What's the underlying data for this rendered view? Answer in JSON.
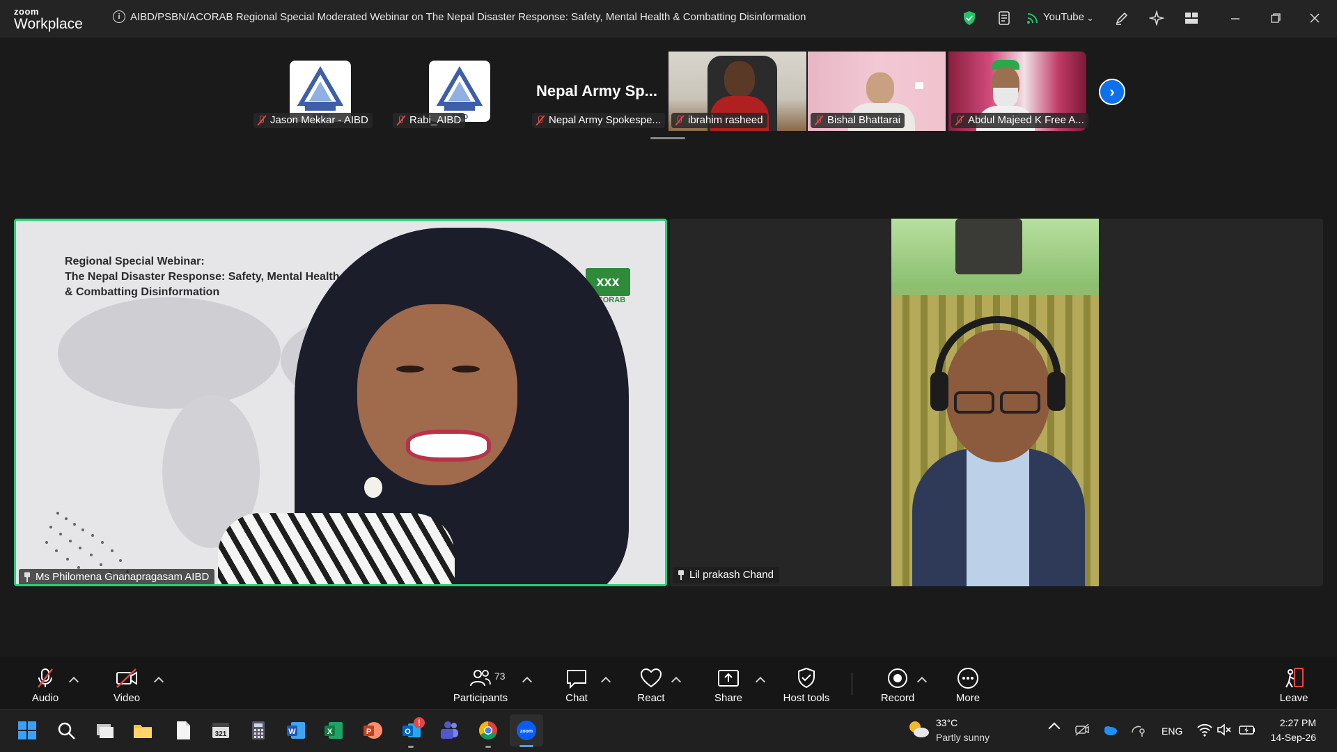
{
  "titlebar": {
    "brand_small": "zoom",
    "brand_large": "Workplace",
    "meeting_title": "AIBD/PSBN/ACORAB Regional Special Moderated Webinar on The Nepal Disaster Response: Safety, Mental Health & Combatting Disinformation",
    "streaming_label": "YouTube"
  },
  "strip": {
    "participants": [
      {
        "name": "Jason Mekkar - AIBD",
        "avatar": "AIBD"
      },
      {
        "name": "Rabi_AIBD",
        "avatar": "AIBD"
      },
      {
        "name": "Nepal Army Spokespe...",
        "avatar_text": "Nepal Army Sp..."
      },
      {
        "name": "ibrahim rasheed"
      },
      {
        "name": "Bishal Bhattarai"
      },
      {
        "name": "Abdul Majeed K Free A..."
      }
    ]
  },
  "main": {
    "left": {
      "name": "Ms Philomena Gnanapragasam AIBD",
      "slide": {
        "line1": "Regional Special Webinar:",
        "line2": "The Nepal Disaster Response:  Safety, Mental Health",
        "line3": "& Combatting Disinformation",
        "logo_text": "ACORAB"
      }
    },
    "right": {
      "name": "Lil prakash Chand"
    }
  },
  "toolbar": {
    "audio": "Audio",
    "video": "Video",
    "participants": "Participants",
    "participant_count": "73",
    "chat": "Chat",
    "react": "React",
    "share": "Share",
    "host_tools": "Host tools",
    "record": "Record",
    "more": "More",
    "leave": "Leave"
  },
  "taskbar": {
    "temperature": "33°C",
    "weather": "Partly sunny",
    "language": "ENG",
    "time": "2:27 PM",
    "date": "14-Sep-26",
    "outlook_badge": "!",
    "calendar_day": "321"
  },
  "colors": {
    "active_speaker": "#24d07a",
    "accent": "#0e71eb",
    "muted": "#e64545"
  }
}
